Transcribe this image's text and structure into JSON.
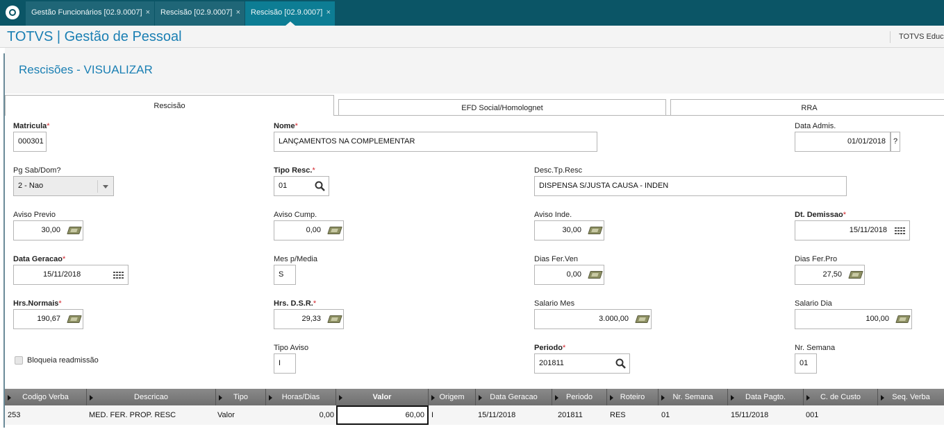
{
  "window_tabs": [
    {
      "label": "Gestão Funcionários [02.9.0007]",
      "close": "×"
    },
    {
      "label": "Rescisão [02.9.0007]",
      "close": "×"
    },
    {
      "label": "Rescisão [02.9.0007]",
      "close": "×",
      "active": true
    }
  ],
  "app": {
    "title": "TOTVS | Gestão de Pessoal",
    "brand": "TOTVS Educa"
  },
  "page": {
    "title": "Rescisões - VISUALIZAR"
  },
  "form_tabs": [
    "Rescisão",
    "EFD Social/Homolognet",
    "RRA"
  ],
  "fields": {
    "matricula": {
      "label": "Matricula",
      "value": "000301"
    },
    "nome": {
      "label": "Nome",
      "value": "LANÇAMENTOS NA COMPLEMENTAR"
    },
    "data_admis": {
      "label": "Data Admis.",
      "value": "01/01/2018",
      "help": "?"
    },
    "pg_sab_dom": {
      "label": "Pg Sab/Dom?",
      "value": "2 - Nao"
    },
    "tipo_resc": {
      "label": "Tipo Resc.",
      "value": "01"
    },
    "desc_tp_resc": {
      "label": "Desc.Tp.Resc",
      "value": "DISPENSA S/JUSTA CAUSA - INDEN"
    },
    "aviso_previo": {
      "label": "Aviso Previo",
      "value": "30,00"
    },
    "aviso_cump": {
      "label": "Aviso Cump.",
      "value": "0,00"
    },
    "aviso_inde": {
      "label": "Aviso Inde.",
      "value": "30,00"
    },
    "dt_demissao": {
      "label": "Dt. Demissao",
      "value": "15/11/2018"
    },
    "data_geracao": {
      "label": "Data Geracao",
      "value": "15/11/2018"
    },
    "mes_p_media": {
      "label": "Mes p/Media",
      "value": "S"
    },
    "dias_fer_ven": {
      "label": "Dias Fer.Ven",
      "value": "0,00"
    },
    "dias_fer_pro": {
      "label": "Dias Fer.Pro",
      "value": "27,50"
    },
    "hrs_normais": {
      "label": "Hrs.Normais",
      "value": "190,67"
    },
    "hrs_dsr": {
      "label": "Hrs. D.S.R.",
      "value": "29,33"
    },
    "salario_mes": {
      "label": "Salario Mes",
      "value": "3.000,00"
    },
    "salario_dia": {
      "label": "Salario Dia",
      "value": "100,00"
    },
    "bloqueia": {
      "label": "Bloqueia readmissão",
      "checked": false
    },
    "tipo_aviso": {
      "label": "Tipo Aviso",
      "value": "I"
    },
    "periodo": {
      "label": "Periodo",
      "value": "201811"
    },
    "nr_semana": {
      "label": "Nr. Semana",
      "value": "01"
    }
  },
  "grid": {
    "columns": [
      "Codigo Verba",
      "Descricao",
      "Tipo",
      "Horas/Dias",
      "Valor",
      "Origem",
      "Data Geracao",
      "Periodo",
      "Roteiro",
      "Nr. Semana",
      "Data Pagto.",
      "C. de Custo",
      "Seq. Verba"
    ],
    "rows": [
      [
        "253",
        "MED. FER. PROP. RESC",
        "Valor",
        "0,00",
        "60,00",
        "I",
        "15/11/2018",
        "201811",
        "RES",
        "01",
        "15/11/2018",
        "001",
        ""
      ]
    ]
  }
}
